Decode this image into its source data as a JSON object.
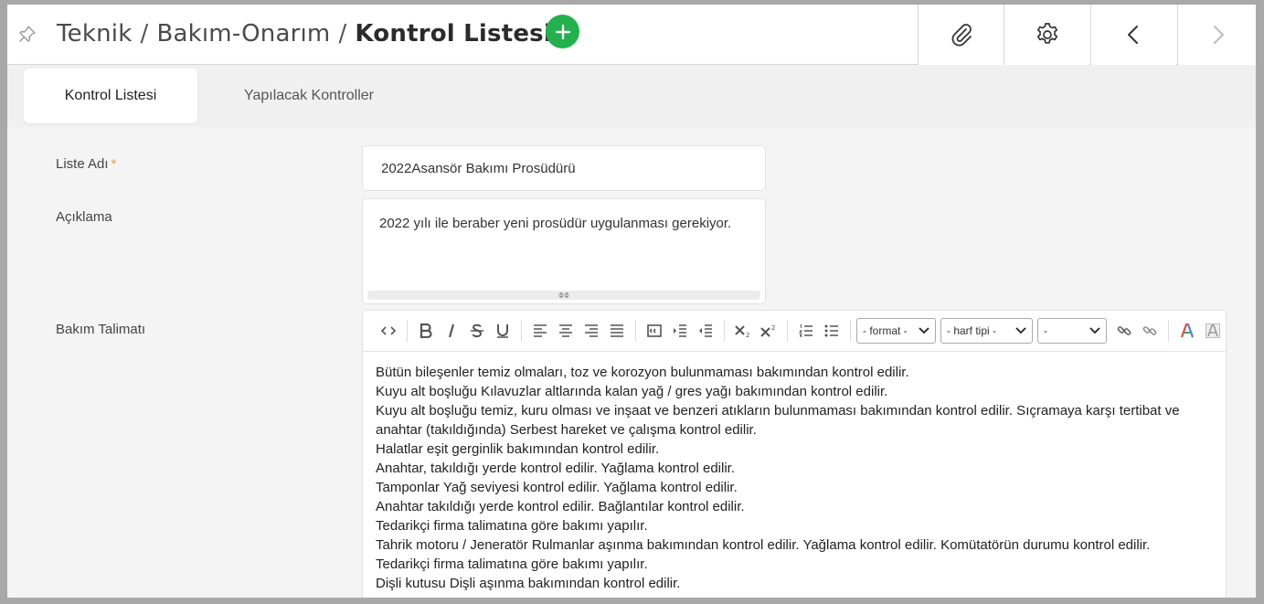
{
  "header": {
    "breadcrumb": [
      "Teknik",
      "Bakım-Onarım"
    ],
    "separator": "/",
    "current": "Kontrol Listesi",
    "add_icon": "plus-icon",
    "toolbar_icons": [
      "paperclip-icon",
      "gear-icon",
      "chevron-left-icon",
      "chevron-right-icon"
    ]
  },
  "tabs": [
    {
      "label": "Kontrol Listesi",
      "active": true
    },
    {
      "label": "Yapılacak Kontroller",
      "active": false
    }
  ],
  "form": {
    "name_label": "Liste Adı",
    "required_mark": "*",
    "name_value": "2022Asansör Bakımı Prosüdürü",
    "desc_label": "Açıklama",
    "desc_value": "2022 yılı ile beraber yeni prosüdür uygulanması gerekiyor.",
    "instr_label": "Bakım Talimatı"
  },
  "editor": {
    "format_select": "- format -",
    "font_select": "- harf tipi -",
    "size_select": "-",
    "lines": [
      "Bütün bileşenler temiz olmaları, toz ve korozyon bulunmaması bakımından kontrol edilir.",
      "Kuyu alt boşluğu Kılavuzlar altlarında kalan yağ / gres yağı bakımından kontrol edilir.",
      "Kuyu alt boşluğu temiz, kuru olması ve inşaat ve benzeri atıkların bulunmaması bakımından kontrol edilir. Sıçramaya karşı tertibat ve anahtar (takıldığında) Serbest hareket ve çalışma kontrol edilir.",
      "Halatlar eşit gerginlik bakımından kontrol edilir.",
      "Anahtar, takıldığı yerde kontrol edilir. Yağlama kontrol edilir.",
      "Tamponlar Yağ seviyesi kontrol edilir. Yağlama kontrol edilir.",
      "Anahtar takıldığı yerde kontrol edilir. Bağlantılar kontrol edilir.",
      "Tedarikçi firma talimatına göre bakımı yapılır.",
      "Tahrik motoru / Jeneratör Rulmanlar aşınma bakımından kontrol edilir. Yağlama kontrol edilir. Komütatörün durumu kontrol edilir.",
      "Tedarikçi firma talimatına göre bakımı yapılır.",
      "Dişli kutusu Dişli aşınma bakımından kontrol edilir."
    ]
  },
  "colors": {
    "add_button": "#22b14c",
    "required": "#f0a030"
  }
}
